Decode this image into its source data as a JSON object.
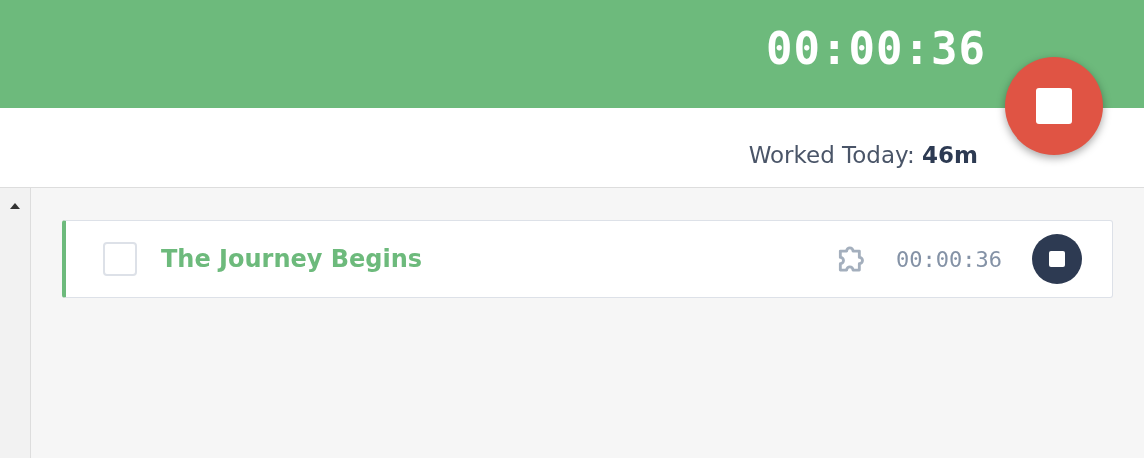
{
  "header": {
    "timer": "00:00:36"
  },
  "summary": {
    "worked_today": "Worked Today: **46m**"
  },
  "tasks": [
    {
      "title": "The Journey Begins",
      "time": "00:00:36",
      "checked": false
    }
  ]
}
